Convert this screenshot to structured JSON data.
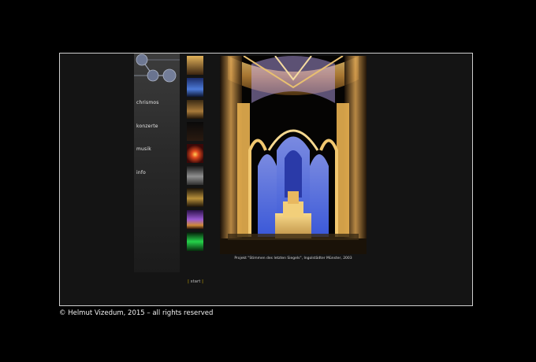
{
  "nav": {
    "items": [
      {
        "label": "chrismos"
      },
      {
        "label": "konzerte"
      },
      {
        "label": "musik"
      },
      {
        "label": "info"
      }
    ]
  },
  "gallery": {
    "thumbnails": [
      {
        "color": "#b8863a"
      },
      {
        "color": "#2a4fa8"
      },
      {
        "color": "#7a5a2a"
      },
      {
        "color": "#101010"
      },
      {
        "color": "#c23a1e"
      },
      {
        "color": "#6a6a6a"
      },
      {
        "color": "#8a6a2a"
      },
      {
        "color": "#6a3aa0"
      },
      {
        "color": "#1fb83a"
      }
    ],
    "caption": "Projekt \"Stimmen des letzten Siegels\", Ingolstädter Münster, 2003"
  },
  "footer": {
    "start_label": "start",
    "copyright": "© Helmut Vizedum, 2015 – all rights reserved"
  },
  "colors": {
    "background": "#000000",
    "panel": "#141414",
    "accent": "#d4b000"
  }
}
